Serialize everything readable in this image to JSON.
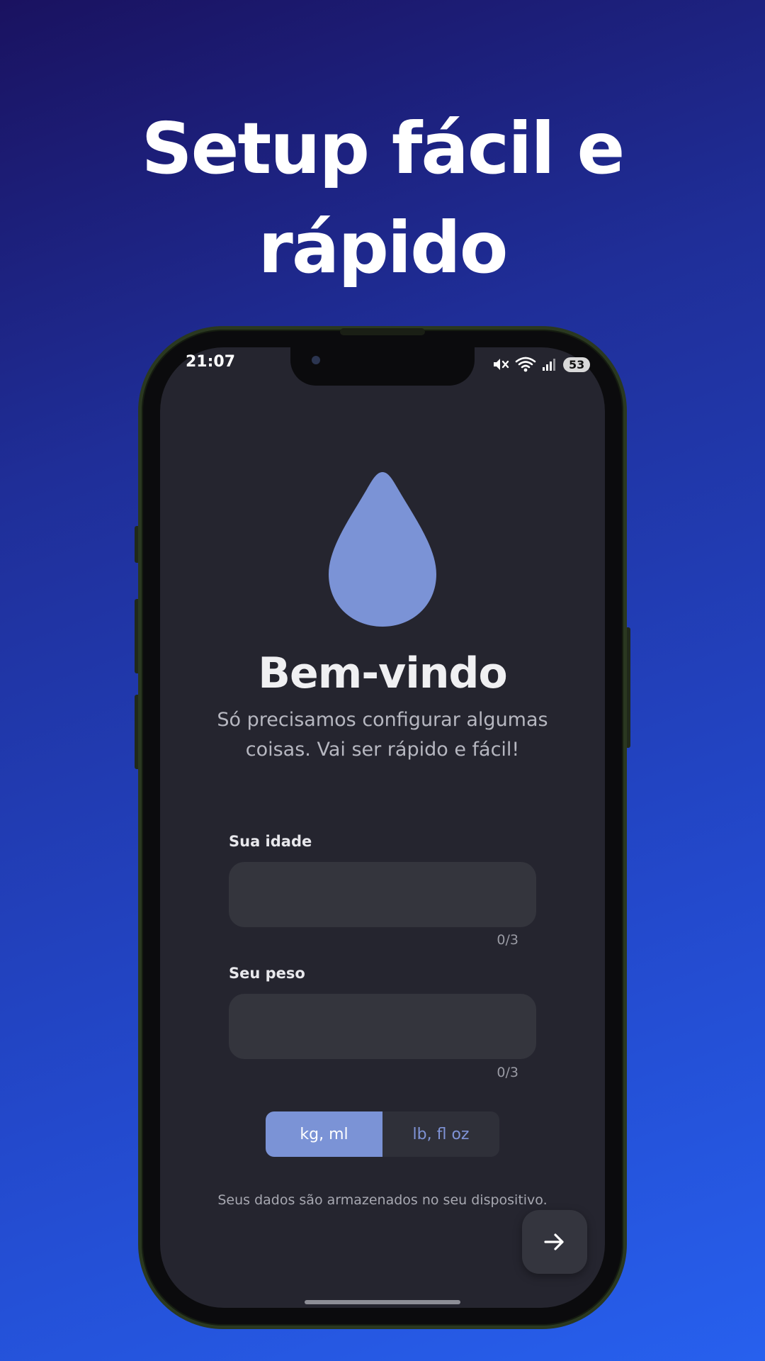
{
  "headline": {
    "line1": "Setup fácil e",
    "line2": "rápido"
  },
  "status_bar": {
    "time": "21:07",
    "battery": "53",
    "icons": [
      "mute-icon",
      "wifi-icon",
      "signal-icon"
    ]
  },
  "welcome": {
    "title": "Bem-vindo",
    "subtitle": "Só precisamos configurar algumas coisas. Vai ser rápido e fácil!"
  },
  "form": {
    "age": {
      "label": "Sua idade",
      "value": "",
      "counter": "0/3"
    },
    "weight": {
      "label": "Seu peso",
      "value": "",
      "counter": "0/3"
    }
  },
  "units": {
    "options": [
      "kg, ml",
      "lb, fl oz"
    ],
    "selected": "kg, ml"
  },
  "footer_note": "Seus dados são armazenados no seu dispositivo.",
  "next_button": {
    "icon": "arrow-right-icon"
  },
  "colors": {
    "accent": "#7b93d6",
    "screen_background": "#25252f",
    "input_background": "#34353d"
  }
}
